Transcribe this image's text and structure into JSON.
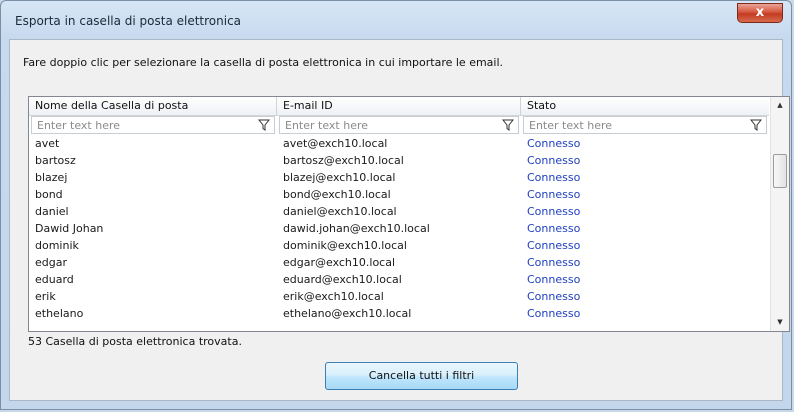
{
  "window": {
    "title": "Esporta in casella di posta elettronica",
    "close_glyph": "x"
  },
  "instruction": "Fare doppio clic per selezionare la casella di posta elettronica in cui importare le email.",
  "grid": {
    "columns": [
      "Nome della Casella di posta",
      "E-mail ID",
      "Stato"
    ],
    "filter_placeholder": "Enter text here",
    "rows": [
      {
        "name": "avet",
        "email": "avet@exch10.local",
        "status": "Connesso"
      },
      {
        "name": "bartosz",
        "email": "bartosz@exch10.local",
        "status": "Connesso"
      },
      {
        "name": "blazej",
        "email": "blazej@exch10.local",
        "status": "Connesso"
      },
      {
        "name": "bond",
        "email": "bond@exch10.local",
        "status": "Connesso"
      },
      {
        "name": "daniel",
        "email": "daniel@exch10.local",
        "status": "Connesso"
      },
      {
        "name": "Dawid Johan",
        "email": "dawid.johan@exch10.local",
        "status": "Connesso"
      },
      {
        "name": "dominik",
        "email": "dominik@exch10.local",
        "status": "Connesso"
      },
      {
        "name": "edgar",
        "email": "edgar@exch10.local",
        "status": "Connesso"
      },
      {
        "name": "eduard",
        "email": "eduard@exch10.local",
        "status": "Connesso"
      },
      {
        "name": "erik",
        "email": "erik@exch10.local",
        "status": "Connesso"
      },
      {
        "name": "ethelano",
        "email": "ethelano@exch10.local",
        "status": "Connesso"
      }
    ]
  },
  "status_text": "53 Casella di posta elettronica trovata.",
  "clear_filters_label": "Cancella tutti i filtri",
  "colors": {
    "status_link": "#1f3fbf",
    "close_button": "#c23b22",
    "window_frame": "#c6d9ee"
  },
  "icons": [
    "close-icon",
    "filter-funnel-icon",
    "scroll-up-arrow-icon",
    "scroll-down-arrow-icon"
  ]
}
